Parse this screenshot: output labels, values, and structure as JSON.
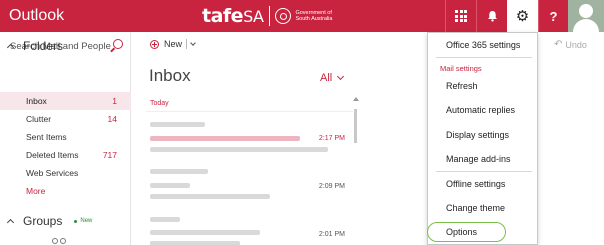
{
  "app": {
    "name": "Outlook"
  },
  "brand": {
    "word_main": "tafe",
    "word_sa": "SA",
    "gov_line1": "Government of",
    "gov_line2": "South Australia"
  },
  "colors": {
    "accent": "#c9243f",
    "selected_bg": "#f8e7ea",
    "highlight_ring": "#7cc04a",
    "new_badge": "#2f8a3a"
  },
  "topbar": {
    "icons": [
      "app-launcher-icon",
      "bell-icon",
      "gear-icon",
      "question-icon"
    ],
    "help_glyph": "?",
    "gear_glyph": "⚙"
  },
  "search": {
    "placeholder": "Search Mail and People"
  },
  "nav": {
    "folders_heading": "Folders",
    "folders": [
      {
        "label": "Inbox",
        "count": "1",
        "selected": true
      },
      {
        "label": "Clutter",
        "count": "14"
      },
      {
        "label": "Sent Items",
        "count": ""
      },
      {
        "label": "Deleted Items",
        "count": "717"
      },
      {
        "label": "Web Services",
        "count": ""
      },
      {
        "label": "More",
        "count": ""
      }
    ],
    "groups_heading": "Groups",
    "groups_badge": "New"
  },
  "command": {
    "new_label": "New",
    "undo_label": "Undo"
  },
  "list": {
    "title": "Inbox",
    "filter_label": "All",
    "group_today": "Today",
    "messages": [
      {
        "time": "2:17 PM",
        "unread": true
      },
      {
        "time": "2:09 PM",
        "unread": false
      },
      {
        "time": "2:01 PM",
        "unread": false
      }
    ]
  },
  "settings_menu": {
    "top_item": "Office 365 settings",
    "mail_settings_heading": "Mail settings",
    "items": [
      "Refresh",
      "Automatic replies",
      "Display settings",
      "Manage add-ins"
    ],
    "bottom_items": [
      "Offline settings",
      "Change theme",
      "Options"
    ]
  }
}
